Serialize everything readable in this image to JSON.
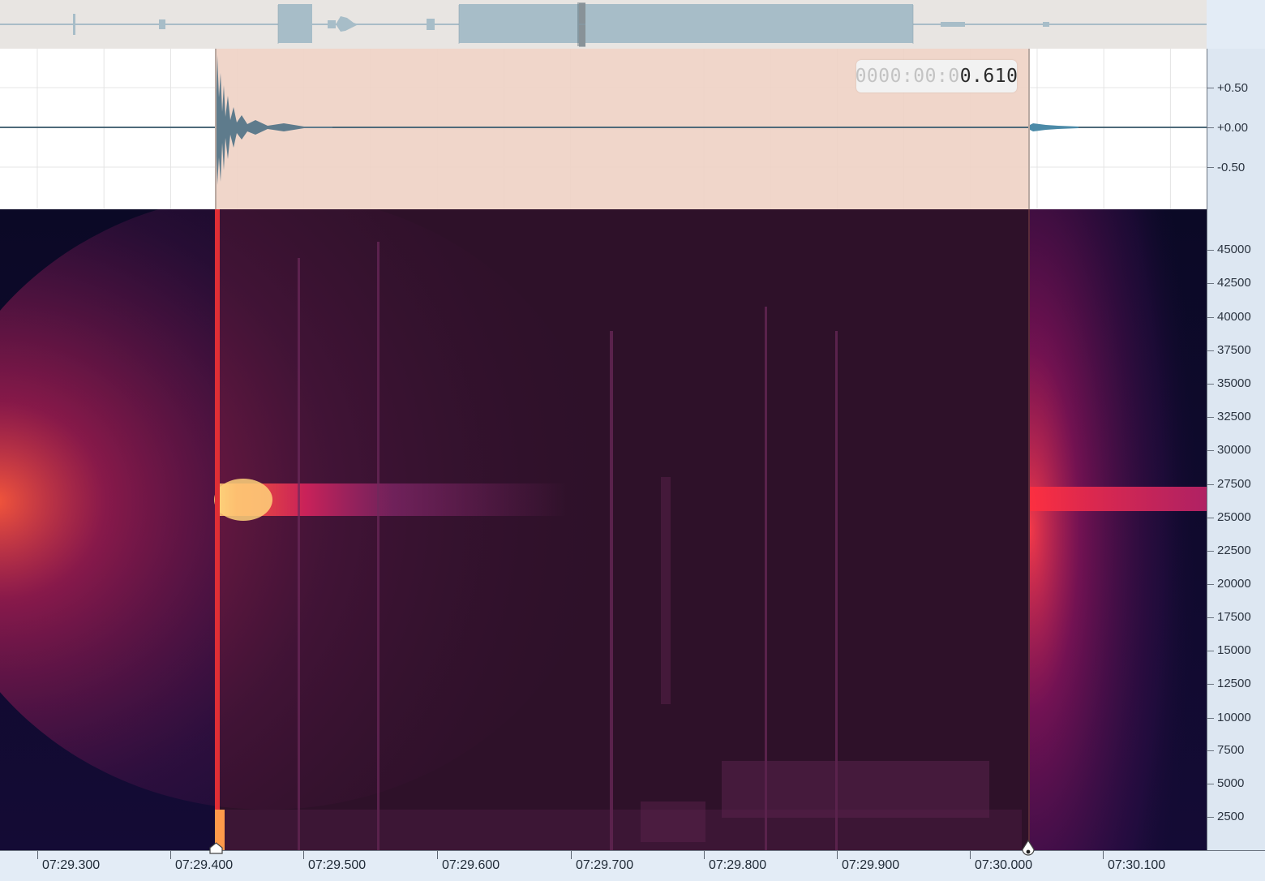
{
  "timecode": {
    "prefix": "0000:00:0",
    "value": "0.610"
  },
  "amplitude_axis": {
    "labels": [
      "+0.50",
      "+0.00",
      "-0.50"
    ]
  },
  "frequency_axis": {
    "labels": [
      "45000",
      "42500",
      "40000",
      "37500",
      "35000",
      "32500",
      "30000",
      "27500",
      "25000",
      "22500",
      "20000",
      "17500",
      "15000",
      "12500",
      "10000",
      "7500",
      "5000",
      "2500"
    ]
  },
  "time_axis": {
    "labels": [
      "07:29.300",
      "07:29.400",
      "07:29.500",
      "07:29.600",
      "07:29.700",
      "07:29.800",
      "07:29.900",
      "07:30.000",
      "07:30.100"
    ]
  },
  "selection": {
    "start": "07:29.400",
    "end": "07:30.010",
    "highlight_color": "#efd3c6"
  },
  "colors": {
    "spectrogram_background": "#0d0a2a",
    "waveform": "#5e7b8c",
    "axis_panel": "#dde7f2"
  }
}
